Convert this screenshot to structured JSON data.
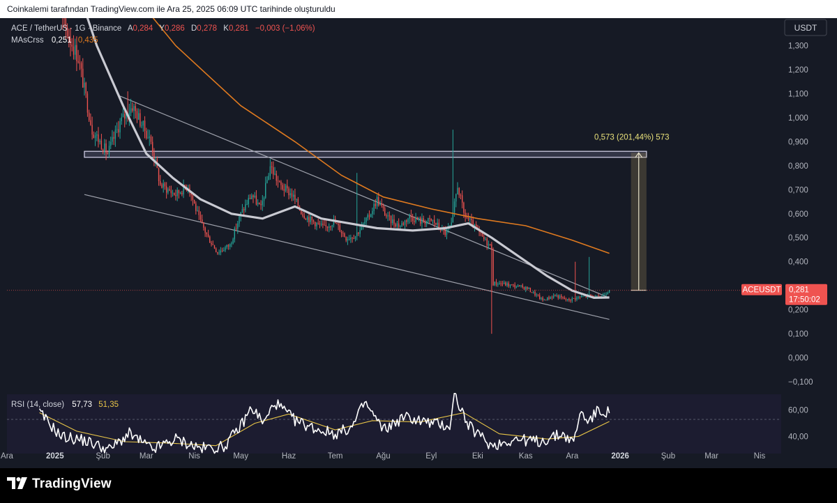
{
  "header": {
    "caption": "Coinkalemi tarafından TradingView.com ile Ara 25, 2025 06:09 UTC tarihinde oluşturuldu"
  },
  "legend": {
    "symbol": "ACE / TetherUS · 1G · Binance",
    "o_label": "A",
    "o_value": "0,284",
    "h_label": "Y",
    "h_value": "0,286",
    "l_label": "D",
    "l_value": "0,278",
    "c_label": "K",
    "c_value": "0,281",
    "change": "−0,003 (−1,06%)",
    "ma_name": "MAsCrss",
    "ma_fast": "0,251",
    "ma_slow": "0,435"
  },
  "price_scale": {
    "currency": "USDT",
    "ticks": [
      "1,300",
      "1,200",
      "1,100",
      "1,000",
      "0,900",
      "0,800",
      "0,700",
      "0,600",
      "0,500",
      "0,400",
      "0,300",
      "0,200",
      "0,100",
      "0,000",
      "−0,100"
    ],
    "last_symbol": "ACEUSDT",
    "last_price": "0,281",
    "countdown": "17:50:02"
  },
  "measure": {
    "label": "0,573 (201,44%) 573"
  },
  "rsi": {
    "label": "RSI (14, close)",
    "value": "57,73",
    "ma_value": "51,35",
    "ticks": [
      "60,00",
      "40,00"
    ]
  },
  "time_axis": [
    "Ara",
    "2025",
    "Şub",
    "Mar",
    "Nis",
    "May",
    "Haz",
    "Tem",
    "Ağu",
    "Eyl",
    "Eki",
    "Kas",
    "Ara",
    "2026",
    "Şub",
    "Mar",
    "Nis"
  ],
  "footer": {
    "brand": "TradingView"
  },
  "colors": {
    "up": "#26a69a",
    "down": "#ef5350",
    "ma_fast": "#c9cad2",
    "ma_slow": "#e07a1f",
    "rsi": "#ffffff",
    "rsi_ma": "#e8c547",
    "background": "#161a25"
  },
  "chart_data": {
    "type": "candlestick",
    "symbol": "ACE / TetherUS",
    "interval": "1G",
    "exchange": "Binance",
    "ylim": [
      -0.1,
      1.38
    ],
    "y_scale": "linear",
    "grid": false,
    "x_range": [
      "2024-12-01",
      "2026-04-15"
    ],
    "price_path": [
      {
        "date": "2024-12-20",
        "price": 1.7
      },
      {
        "date": "2025-01-06",
        "price": 1.4
      },
      {
        "date": "2025-01-16",
        "price": 1.25
      },
      {
        "date": "2025-01-25",
        "price": 0.95
      },
      {
        "date": "2025-02-04",
        "price": 0.85
      },
      {
        "date": "2025-02-12",
        "price": 0.98
      },
      {
        "date": "2025-02-20",
        "price": 1.05
      },
      {
        "date": "2025-03-04",
        "price": 0.9
      },
      {
        "date": "2025-03-10",
        "price": 0.72
      },
      {
        "date": "2025-03-20",
        "price": 0.68
      },
      {
        "date": "2025-03-28",
        "price": 0.72
      },
      {
        "date": "2025-04-04",
        "price": 0.58
      },
      {
        "date": "2025-04-10",
        "price": 0.5
      },
      {
        "date": "2025-04-16",
        "price": 0.44
      },
      {
        "date": "2025-04-24",
        "price": 0.47
      },
      {
        "date": "2025-05-01",
        "price": 0.6
      },
      {
        "date": "2025-05-08",
        "price": 0.68
      },
      {
        "date": "2025-05-14",
        "price": 0.62
      },
      {
        "date": "2025-05-20",
        "price": 0.8
      },
      {
        "date": "2025-05-26",
        "price": 0.72
      },
      {
        "date": "2025-06-03",
        "price": 0.68
      },
      {
        "date": "2025-06-10",
        "price": 0.6
      },
      {
        "date": "2025-06-16",
        "price": 0.57
      },
      {
        "date": "2025-06-24",
        "price": 0.54
      },
      {
        "date": "2025-06-30",
        "price": 0.57
      },
      {
        "date": "2025-07-08",
        "price": 0.5
      },
      {
        "date": "2025-07-14",
        "price": 0.51
      },
      {
        "date": "2025-07-22",
        "price": 0.58
      },
      {
        "date": "2025-07-28",
        "price": 0.66
      },
      {
        "date": "2025-08-04",
        "price": 0.58
      },
      {
        "date": "2025-08-12",
        "price": 0.55
      },
      {
        "date": "2025-08-18",
        "price": 0.59
      },
      {
        "date": "2025-08-25",
        "price": 0.57
      },
      {
        "date": "2025-09-02",
        "price": 0.57
      },
      {
        "date": "2025-09-10",
        "price": 0.52
      },
      {
        "date": "2025-09-14",
        "price": 0.55
      },
      {
        "date": "2025-09-18",
        "price": 0.72
      },
      {
        "date": "2025-09-22",
        "price": 0.6
      },
      {
        "date": "2025-09-28",
        "price": 0.55
      },
      {
        "date": "2025-10-04",
        "price": 0.5
      },
      {
        "date": "2025-10-10",
        "price": 0.46
      },
      {
        "date": "2025-10-11",
        "price": 0.31
      },
      {
        "date": "2025-10-16",
        "price": 0.31
      },
      {
        "date": "2025-10-24",
        "price": 0.3
      },
      {
        "date": "2025-11-02",
        "price": 0.29
      },
      {
        "date": "2025-11-12",
        "price": 0.24
      },
      {
        "date": "2025-11-20",
        "price": 0.26
      },
      {
        "date": "2025-11-28",
        "price": 0.24
      },
      {
        "date": "2025-12-04",
        "price": 0.25
      },
      {
        "date": "2025-12-12",
        "price": 0.26
      },
      {
        "date": "2025-12-18",
        "price": 0.25
      },
      {
        "date": "2025-12-25",
        "price": 0.281
      }
    ],
    "spikes": [
      {
        "date": "2025-09-15",
        "high": 0.95
      },
      {
        "date": "2025-07-15",
        "high": 0.77
      },
      {
        "date": "2025-10-10",
        "low": 0.1
      },
      {
        "date": "2025-12-12",
        "high": 0.42
      },
      {
        "date": "2025-12-03",
        "high": 0.4
      },
      {
        "date": "2025-02-17",
        "high": 1.11
      }
    ],
    "ma_fast_path": [
      {
        "date": "2025-01-15",
        "price": 1.55
      },
      {
        "date": "2025-01-28",
        "price": 1.3
      },
      {
        "date": "2025-02-14",
        "price": 1.05
      },
      {
        "date": "2025-03-01",
        "price": 0.85
      },
      {
        "date": "2025-03-18",
        "price": 0.75
      },
      {
        "date": "2025-04-05",
        "price": 0.66
      },
      {
        "date": "2025-04-25",
        "price": 0.6
      },
      {
        "date": "2025-05-15",
        "price": 0.58
      },
      {
        "date": "2025-06-05",
        "price": 0.63
      },
      {
        "date": "2025-06-22",
        "price": 0.58
      },
      {
        "date": "2025-07-10",
        "price": 0.56
      },
      {
        "date": "2025-07-28",
        "price": 0.54
      },
      {
        "date": "2025-08-20",
        "price": 0.53
      },
      {
        "date": "2025-09-10",
        "price": 0.54
      },
      {
        "date": "2025-09-25",
        "price": 0.56
      },
      {
        "date": "2025-10-10",
        "price": 0.5
      },
      {
        "date": "2025-10-28",
        "price": 0.42
      },
      {
        "date": "2025-11-15",
        "price": 0.34
      },
      {
        "date": "2025-12-01",
        "price": 0.28
      },
      {
        "date": "2025-12-15",
        "price": 0.25
      },
      {
        "date": "2025-12-25",
        "price": 0.251
      }
    ],
    "ma_slow_path": [
      {
        "date": "2025-02-10",
        "price": 1.6
      },
      {
        "date": "2025-03-20",
        "price": 1.3
      },
      {
        "date": "2025-05-01",
        "price": 1.05
      },
      {
        "date": "2025-06-05",
        "price": 0.9
      },
      {
        "date": "2025-07-05",
        "price": 0.76
      },
      {
        "date": "2025-08-01",
        "price": 0.67
      },
      {
        "date": "2025-09-01",
        "price": 0.62
      },
      {
        "date": "2025-10-01",
        "price": 0.58
      },
      {
        "date": "2025-11-01",
        "price": 0.55
      },
      {
        "date": "2025-12-01",
        "price": 0.49
      },
      {
        "date": "2025-12-25",
        "price": 0.435
      }
    ],
    "trendlines": [
      {
        "from": {
          "date": "2025-02-12",
          "price": 1.09
        },
        "to": {
          "date": "2025-12-25",
          "price": 0.25
        }
      },
      {
        "from": {
          "date": "2025-01-20",
          "price": 0.68
        },
        "to": {
          "date": "2025-12-25",
          "price": 0.16
        }
      }
    ],
    "resistance_zone": {
      "from": "2025-01-20",
      "to": "2026-01-18",
      "top": 0.86,
      "bottom": 0.835
    },
    "measurement": {
      "from": "2026-01-08",
      "to": "2026-01-18",
      "bottom": 0.281,
      "top": 0.854,
      "change": 0.573,
      "percent": 201.44
    },
    "rsi": {
      "period": 14,
      "source": "close",
      "ylim": [
        27,
        72
      ],
      "level": 50,
      "values": [
        {
          "date": "2024-12-22",
          "value": 58
        },
        {
          "date": "2025-01-05",
          "value": 40
        },
        {
          "date": "2025-01-20",
          "value": 37
        },
        {
          "date": "2025-02-05",
          "value": 30
        },
        {
          "date": "2025-02-18",
          "value": 42
        },
        {
          "date": "2025-03-05",
          "value": 30
        },
        {
          "date": "2025-03-20",
          "value": 38
        },
        {
          "date": "2025-04-05",
          "value": 31
        },
        {
          "date": "2025-04-20",
          "value": 32
        },
        {
          "date": "2025-05-01",
          "value": 48
        },
        {
          "date": "2025-05-08",
          "value": 62
        },
        {
          "date": "2025-05-16",
          "value": 50
        },
        {
          "date": "2025-05-23",
          "value": 66
        },
        {
          "date": "2025-06-05",
          "value": 52
        },
        {
          "date": "2025-06-18",
          "value": 46
        },
        {
          "date": "2025-07-01",
          "value": 42
        },
        {
          "date": "2025-07-12",
          "value": 47
        },
        {
          "date": "2025-07-20",
          "value": 66
        },
        {
          "date": "2025-08-01",
          "value": 45
        },
        {
          "date": "2025-08-15",
          "value": 55
        },
        {
          "date": "2025-09-01",
          "value": 50
        },
        {
          "date": "2025-09-13",
          "value": 48
        },
        {
          "date": "2025-09-16",
          "value": 72
        },
        {
          "date": "2025-09-25",
          "value": 48
        },
        {
          "date": "2025-10-10",
          "value": 33
        },
        {
          "date": "2025-10-25",
          "value": 38
        },
        {
          "date": "2025-11-10",
          "value": 36
        },
        {
          "date": "2025-11-25",
          "value": 42
        },
        {
          "date": "2025-12-02",
          "value": 35
        },
        {
          "date": "2025-12-06",
          "value": 58
        },
        {
          "date": "2025-12-12",
          "value": 52
        },
        {
          "date": "2025-12-18",
          "value": 60
        },
        {
          "date": "2025-12-25",
          "value": 57.73
        }
      ],
      "ma": [
        {
          "date": "2024-12-22",
          "value": 58
        },
        {
          "date": "2025-01-15",
          "value": 44
        },
        {
          "date": "2025-02-15",
          "value": 36
        },
        {
          "date": "2025-03-15",
          "value": 35
        },
        {
          "date": "2025-04-15",
          "value": 33
        },
        {
          "date": "2025-05-10",
          "value": 50
        },
        {
          "date": "2025-06-01",
          "value": 57
        },
        {
          "date": "2025-07-01",
          "value": 45
        },
        {
          "date": "2025-07-25",
          "value": 52
        },
        {
          "date": "2025-08-25",
          "value": 51
        },
        {
          "date": "2025-09-22",
          "value": 58
        },
        {
          "date": "2025-10-15",
          "value": 42
        },
        {
          "date": "2025-11-15",
          "value": 38
        },
        {
          "date": "2025-12-05",
          "value": 40
        },
        {
          "date": "2025-12-25",
          "value": 51.35
        }
      ]
    }
  }
}
